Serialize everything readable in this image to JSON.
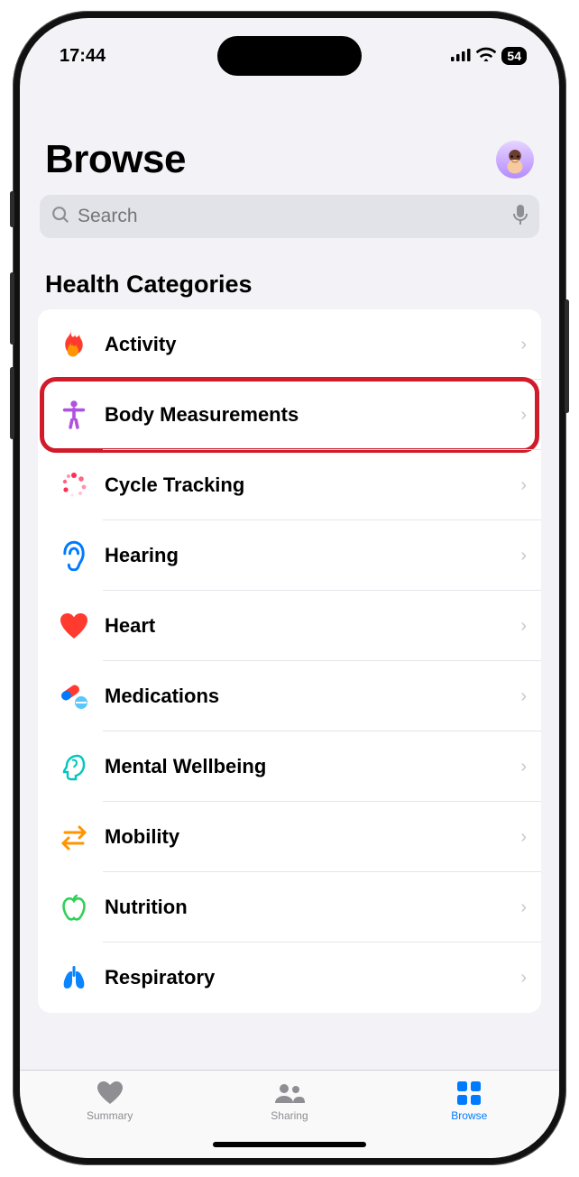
{
  "status": {
    "time": "17:44",
    "battery": "54"
  },
  "header": {
    "title": "Browse"
  },
  "search": {
    "placeholder": "Search"
  },
  "section": {
    "title": "Health Categories"
  },
  "categories": [
    {
      "label": "Activity"
    },
    {
      "label": "Body Measurements"
    },
    {
      "label": "Cycle Tracking"
    },
    {
      "label": "Hearing"
    },
    {
      "label": "Heart"
    },
    {
      "label": "Medications"
    },
    {
      "label": "Mental Wellbeing"
    },
    {
      "label": "Mobility"
    },
    {
      "label": "Nutrition"
    },
    {
      "label": "Respiratory"
    }
  ],
  "tabs": [
    {
      "label": "Summary"
    },
    {
      "label": "Sharing"
    },
    {
      "label": "Browse"
    }
  ]
}
